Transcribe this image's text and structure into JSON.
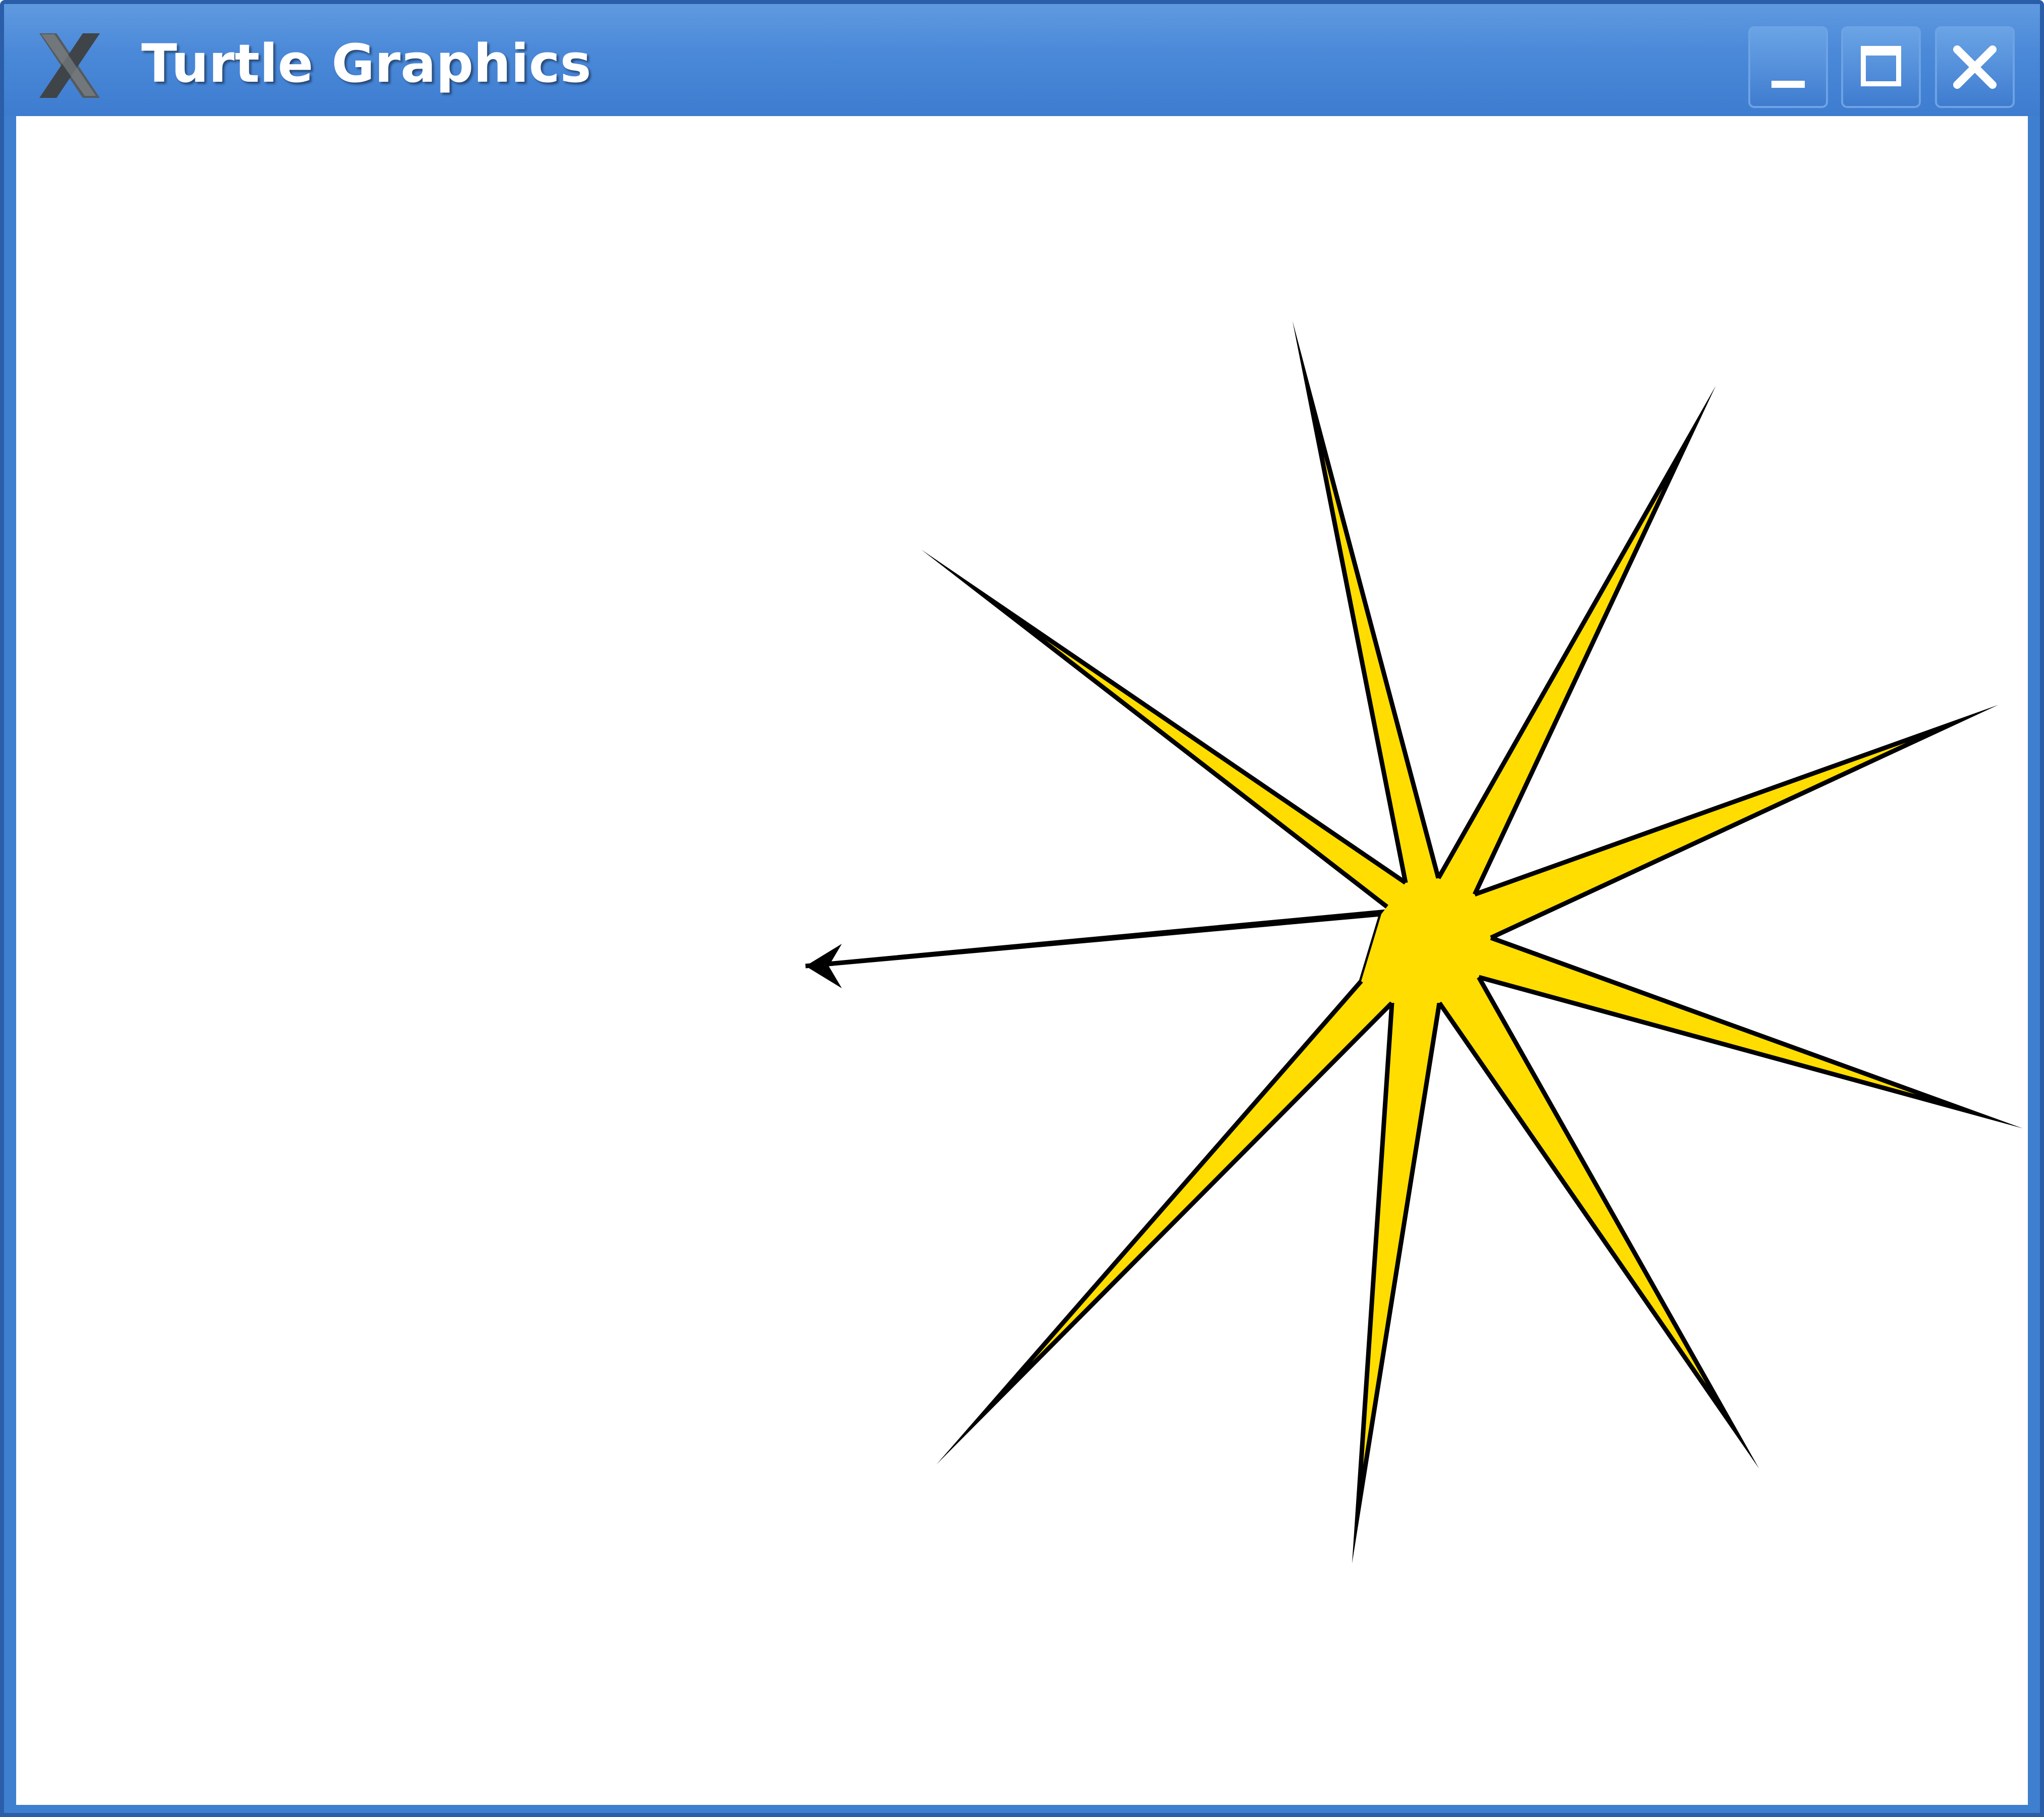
{
  "window": {
    "title": "Turtle Graphics",
    "app_icon": "x11-logo-icon",
    "controls": {
      "minimize": "minimize-icon",
      "maximize": "maximize-icon",
      "close": "close-icon"
    }
  },
  "drawing": {
    "fill_color": "#FFDD00",
    "stroke_color": "#000000",
    "background_color": "#FFFFFF",
    "turtle_icon": "turtle-arrow-icon",
    "shape": "star-burst",
    "spikes": 10
  }
}
